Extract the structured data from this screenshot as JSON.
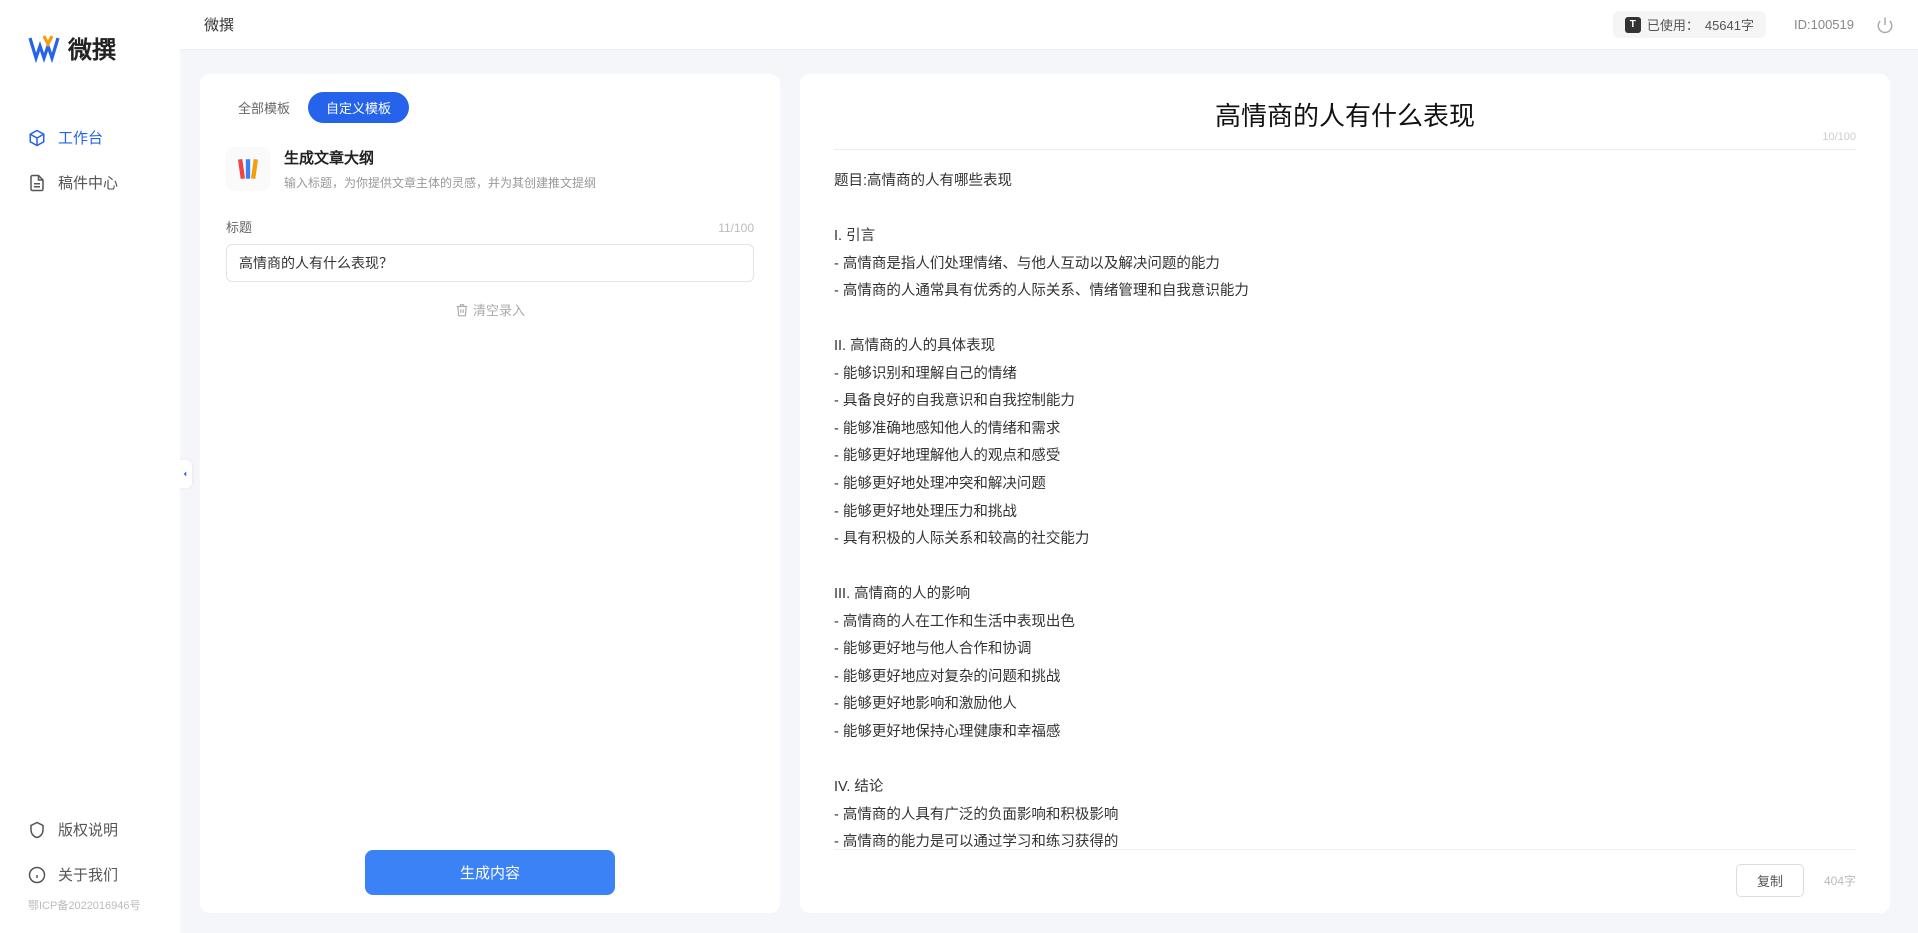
{
  "app_name": "微撰",
  "topbar": {
    "title": "微撰",
    "usage_label": "已使用：",
    "usage_value": "45641字",
    "id_label": "ID:100519"
  },
  "sidebar": {
    "nav": [
      {
        "label": "工作台",
        "key": "workspace"
      },
      {
        "label": "稿件中心",
        "key": "drafts"
      }
    ],
    "bottom": [
      {
        "label": "版权说明",
        "key": "copyright"
      },
      {
        "label": "关于我们",
        "key": "about"
      }
    ],
    "icp": "鄂ICP备2022016946号"
  },
  "tabs": {
    "all": "全部模板",
    "custom": "自定义模板"
  },
  "template": {
    "title": "生成文章大纲",
    "subtitle": "输入标题，为你提供文章主体的灵感，并为其创建推文提纲"
  },
  "form": {
    "title_label": "标题",
    "title_counter": "11/100",
    "title_value": "高情商的人有什么表现？",
    "reset_label": "清空录入",
    "generate_label": "生成内容"
  },
  "output": {
    "title": "高情商的人有什么表现",
    "title_counter": "10/100",
    "body": "题目:高情商的人有哪些表现\n\nI. 引言\n- 高情商是指人们处理情绪、与他人互动以及解决问题的能力\n- 高情商的人通常具有优秀的人际关系、情绪管理和自我意识能力\n\nII. 高情商的人的具体表现\n- 能够识别和理解自己的情绪\n- 具备良好的自我意识和自我控制能力\n- 能够准确地感知他人的情绪和需求\n- 能够更好地理解他人的观点和感受\n- 能够更好地处理冲突和解决问题\n- 能够更好地处理压力和挑战\n- 具有积极的人际关系和较高的社交能力\n\nIII. 高情商的人的影响\n- 高情商的人在工作和生活中表现出色\n- 能够更好地与他人合作和协调\n- 能够更好地应对复杂的问题和挑战\n- 能够更好地影响和激励他人\n- 能够更好地保持心理健康和幸福感\n\nIV. 结论\n- 高情商的人具有广泛的负面影响和积极影响\n- 高情商的能力是可以通过学习和练习获得的\n- 培养和提高高情商的能力对于个人的职业发展和生活质量至关重要。",
    "copy_label": "复制",
    "word_count": "404字"
  }
}
